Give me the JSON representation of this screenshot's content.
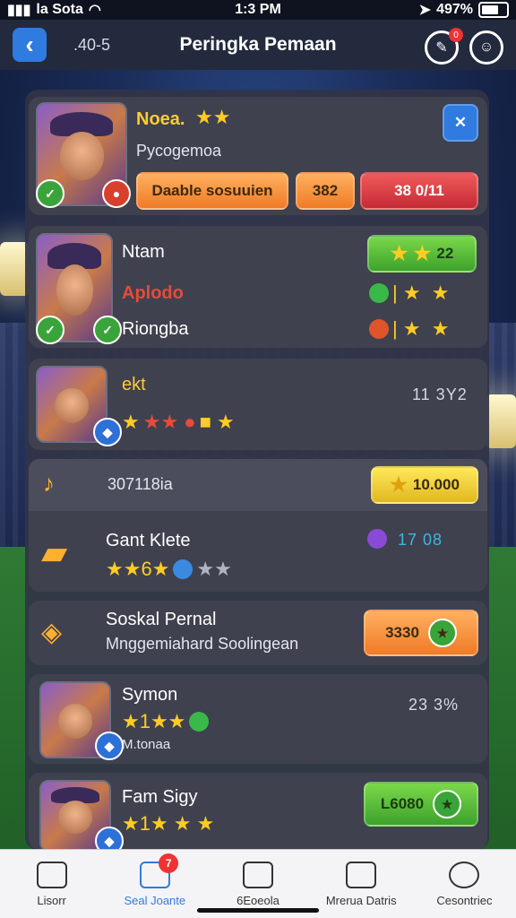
{
  "status_bar": {
    "carrier": "la Sota",
    "time": "1:3 PM",
    "battery": "497%"
  },
  "header": {
    "back_label": "‹",
    "code": ".40-5",
    "title": "Peringka Pemaan",
    "notif_count": "0"
  },
  "cards": [
    {
      "name": "Noea.",
      "subtitle": "Pycogemoa",
      "action_label": "Daable sosuuien",
      "value_a": "382",
      "value_b": "38 0/11",
      "close_label": "✕"
    },
    {
      "line1": "Ntam",
      "line2": "Aplodo",
      "line3": "Riongba",
      "score": "22"
    },
    {
      "name": "ekt",
      "stats": "11  3Y2"
    },
    {
      "section_label": "307118ia",
      "reward": "10.000"
    },
    {
      "name": "Gant Klete",
      "stats": "17  08"
    },
    {
      "title": "Soskal Pernal",
      "subtitle": "Mnggemiahard Soolingean",
      "action_label": "3330"
    },
    {
      "name": "Symon",
      "sub": "M.tonaa",
      "stats": "23  3%"
    },
    {
      "name": "Fam Sigy",
      "action_label": "L6080"
    }
  ],
  "nav": [
    {
      "label": "Lisorr",
      "icon": "home-icon"
    },
    {
      "label": "Seal Joante",
      "icon": "upload-icon",
      "badge": "7"
    },
    {
      "label": "6Eoeola",
      "icon": "document-icon"
    },
    {
      "label": "Mrerua Datris",
      "icon": "briefcase-icon"
    },
    {
      "label": "Cesontriec",
      "icon": "gear-icon"
    }
  ],
  "colors": {
    "accent": "#2f7be0",
    "panel": "#3f414f",
    "header": "#232a3e"
  }
}
